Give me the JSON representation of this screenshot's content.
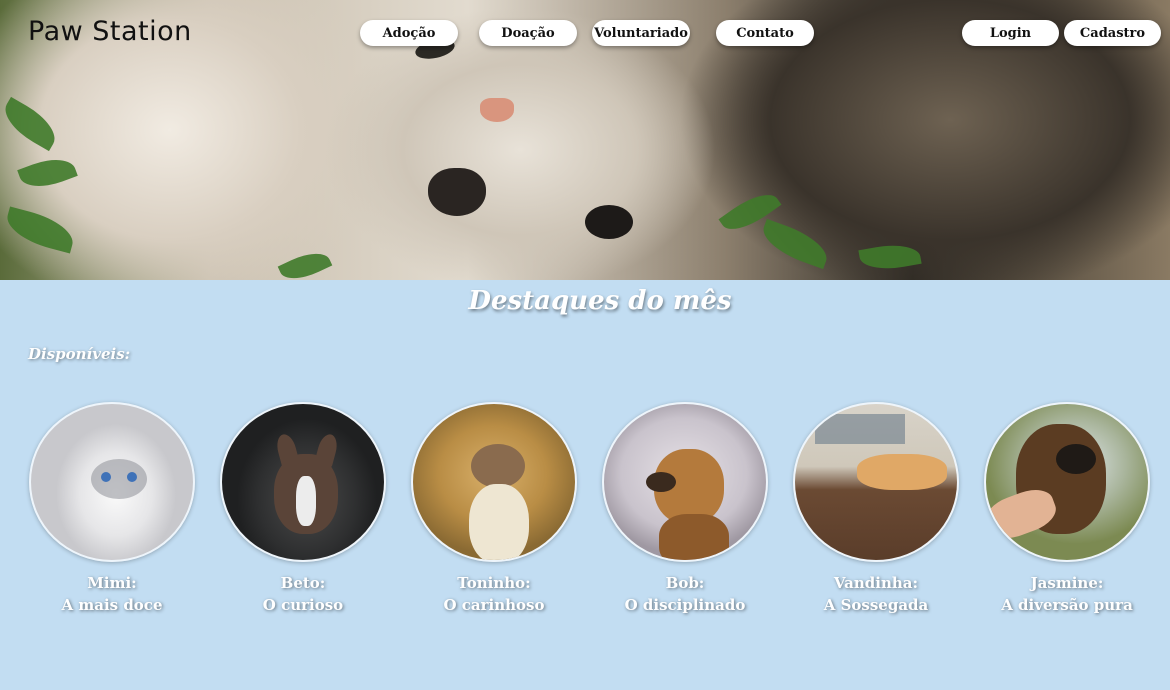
{
  "header": {
    "logo": "Paw Station",
    "nav": [
      {
        "label": "Adoção"
      },
      {
        "label": "Doação"
      },
      {
        "label": "Voluntariado"
      },
      {
        "label": "Contato"
      }
    ],
    "auth": [
      {
        "label": "Login"
      },
      {
        "label": "Cadastro"
      }
    ]
  },
  "main": {
    "title": "Destaques do mês",
    "available_label": "Disponíveis:",
    "pets": [
      {
        "name": "Mimi:",
        "tagline": "A mais doce"
      },
      {
        "name": "Beto:",
        "tagline": "O curioso"
      },
      {
        "name": "Toninho:",
        "tagline": "O carinhoso"
      },
      {
        "name": "Bob:",
        "tagline": "O disciplinado"
      },
      {
        "name": "Vandinha:",
        "tagline": "A Sossegada"
      },
      {
        "name": "Jasmine:",
        "tagline": "A diversão pura"
      }
    ]
  },
  "colors": {
    "background": "#c2ddf2",
    "pill": "#ffffff",
    "text_light": "#ffffff"
  }
}
